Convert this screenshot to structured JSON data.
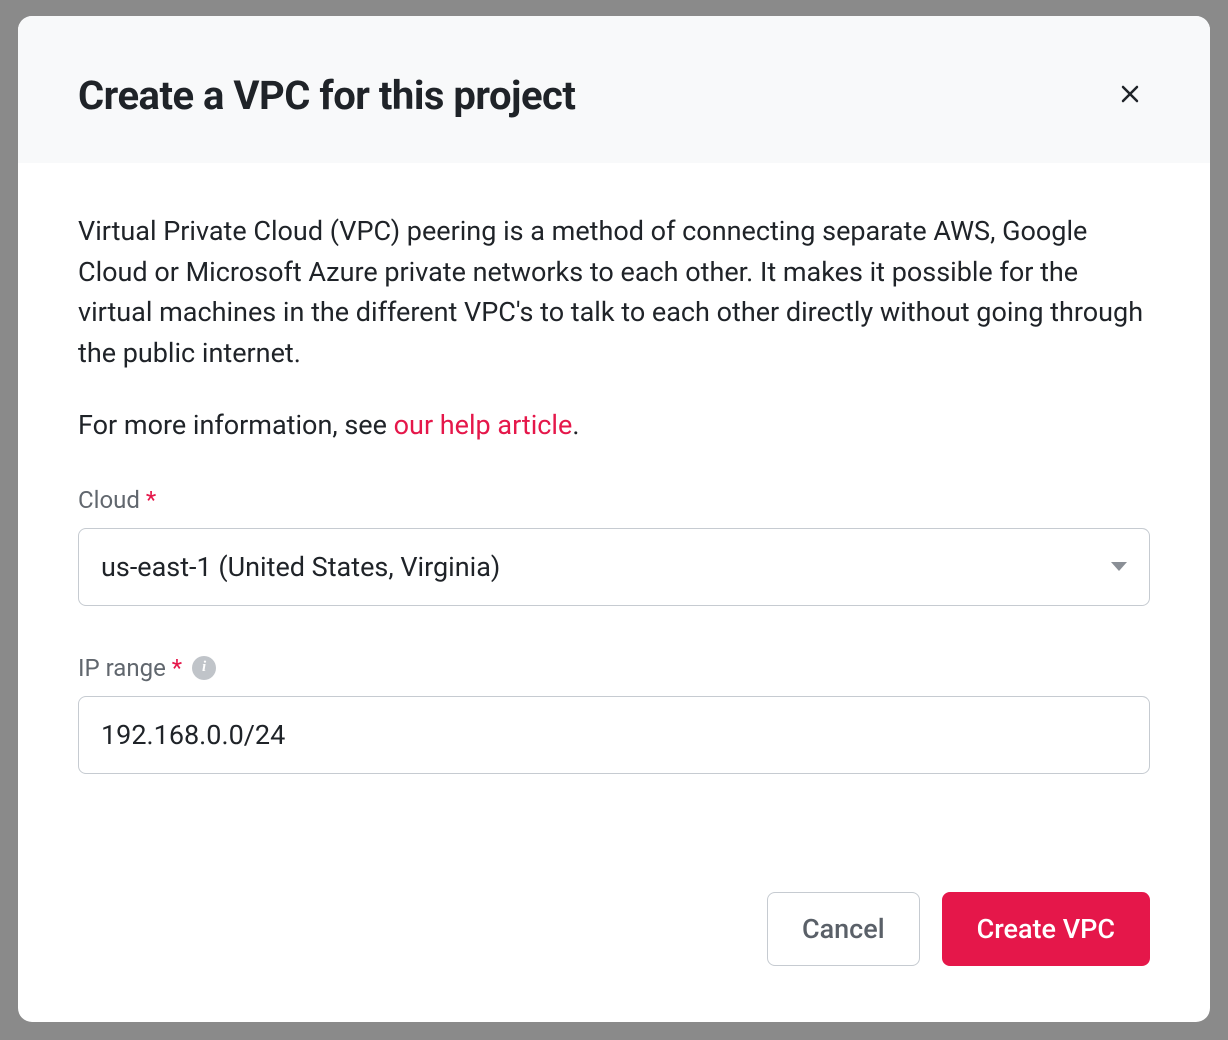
{
  "modal": {
    "title": "Create a VPC for this project",
    "description": "Virtual Private Cloud (VPC) peering is a method of connecting separate AWS, Google Cloud or Microsoft Azure private networks to each other. It makes it possible for the virtual machines in the different VPC's to talk to each other directly without going through the public internet.",
    "info_prefix": "For more information, see ",
    "info_link": "our help article",
    "info_suffix": ".",
    "form": {
      "cloud_label": "Cloud",
      "cloud_value": "us-east-1 (United States, Virginia)",
      "ip_range_label": "IP range",
      "ip_range_value": "192.168.0.0/24"
    },
    "buttons": {
      "cancel": "Cancel",
      "create": "Create VPC"
    }
  }
}
